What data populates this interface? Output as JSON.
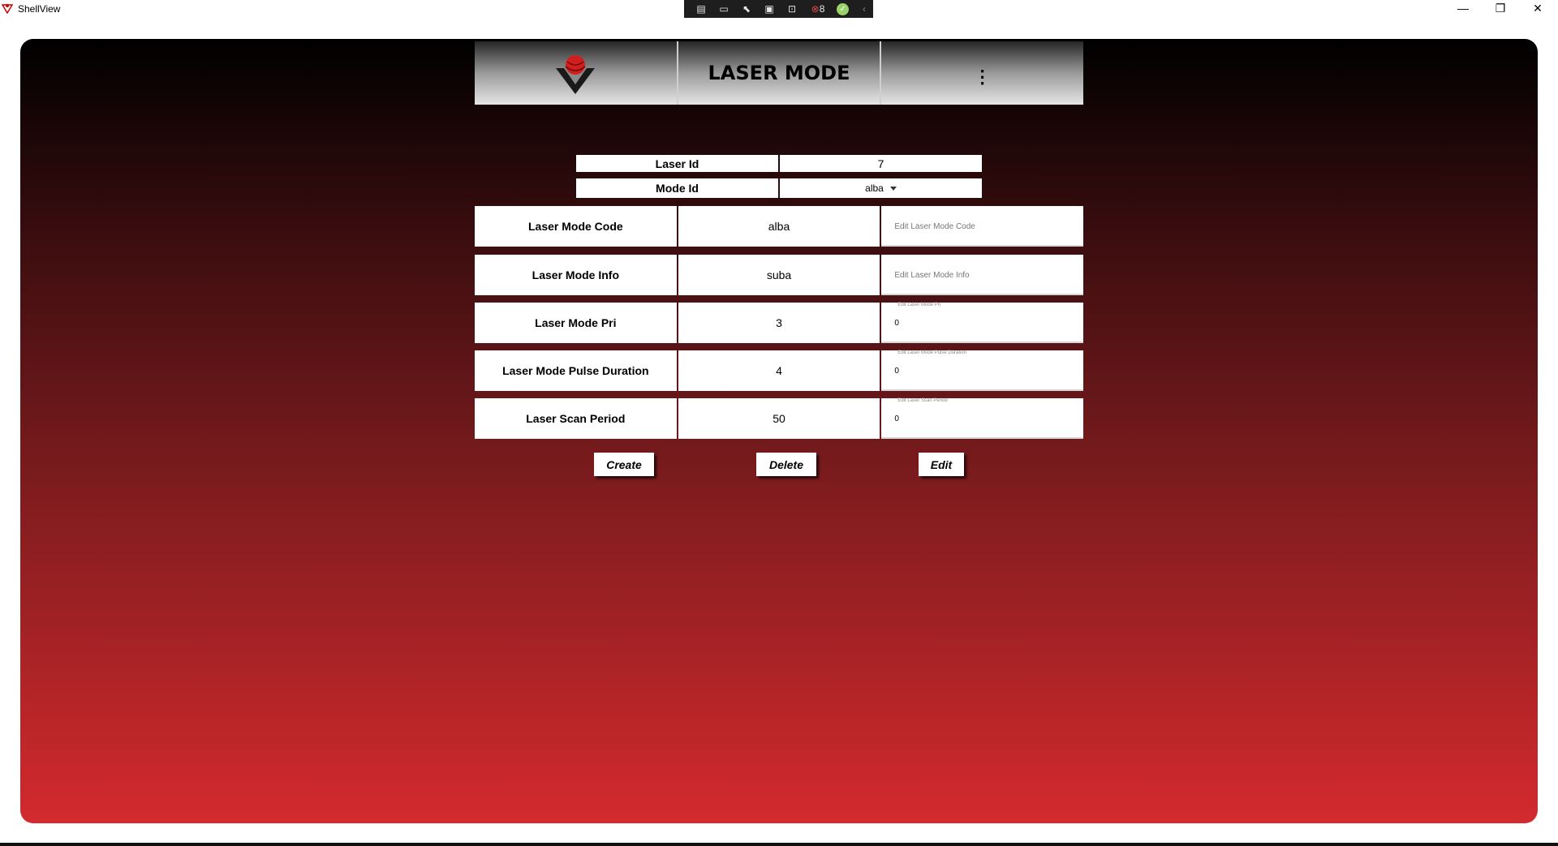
{
  "window": {
    "title": "ShellView",
    "minimize": "—",
    "restore": "❐",
    "close": "✕"
  },
  "debug_toolbar": {
    "icons": [
      "live-visual-tree-icon",
      "camera-icon",
      "select-element-icon",
      "display-layout-icon",
      "track-focus-icon",
      "binding-failures-icon"
    ],
    "binding_failures_count": "8",
    "collapse": "‹"
  },
  "header": {
    "title": "LASER MODE",
    "menu_glyph": "⋮"
  },
  "info": {
    "laser_id_label": "Laser Id",
    "laser_id_value": "7",
    "mode_id_label": "Mode Id",
    "mode_id_value": "alba"
  },
  "rows": [
    {
      "label": "Laser Mode Code",
      "value": "alba",
      "input_value": "",
      "input_placeholder": "Edit Laser Mode Code",
      "float_label": ""
    },
    {
      "label": "Laser Mode Info",
      "value": "suba",
      "input_value": "",
      "input_placeholder": "Edit Laser Mode Info",
      "float_label": ""
    },
    {
      "label": "Laser Mode Pri",
      "value": "3",
      "input_value": "0",
      "input_placeholder": "",
      "float_label": "Edit Laser Mode Pri"
    },
    {
      "label": "Laser Mode Pulse Duration",
      "value": "4",
      "input_value": "0",
      "input_placeholder": "",
      "float_label": "Edit Laser Mode Pulse Duration"
    },
    {
      "label": "Laser Scan Period",
      "value": "50",
      "input_value": "0",
      "input_placeholder": "",
      "float_label": "Edit Laser Scan Period"
    }
  ],
  "buttons": {
    "create": "Create",
    "delete": "Delete",
    "edit": "Edit"
  },
  "colors": {
    "gradient_top": "#000000",
    "gradient_bottom": "#d42a2e",
    "logo_red": "#d11f1f"
  }
}
